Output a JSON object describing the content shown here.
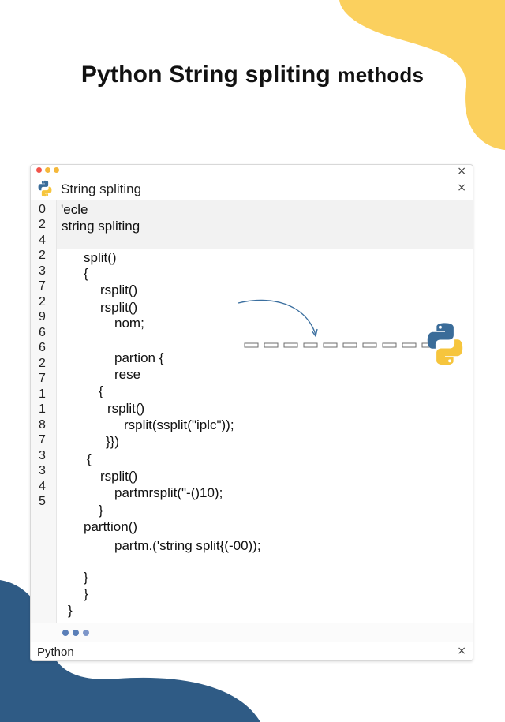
{
  "colors": {
    "yellow_blob": "#fbd05e",
    "blue_blob": "#2f5b85",
    "accent_blue": "#3b6f9f",
    "py_yellow": "#f6c53d",
    "py_blue": "#3a6c99"
  },
  "title": {
    "main": "Python String spliting",
    "suffix": "methods"
  },
  "window": {
    "tab_title": "String spliting",
    "close_glyph": "×",
    "status_language": "Python"
  },
  "line_numbers": [
    "0",
    "2",
    "4",
    "2",
    "3",
    "7",
    "2",
    "9",
    "6",
    "6",
    "2",
    "7",
    "1",
    "1",
    "8",
    "7",
    "3",
    "3",
    "4",
    "5"
  ],
  "code_lines": [
    "'ecle",
    "string spliting",
    "split()",
    "{",
    "rsplit()",
    "rsplit()",
    "nom;",
    "partion {",
    "rese",
    "{",
    "rsplit()",
    "rsplit(ssplit(\"iplc\"));",
    "}})",
    "{",
    "rsplit()",
    "partmrsplit(\"-()10);",
    "}",
    "parttion()",
    "partm.('string split{(-00));",
    "}",
    "}",
    "}"
  ]
}
